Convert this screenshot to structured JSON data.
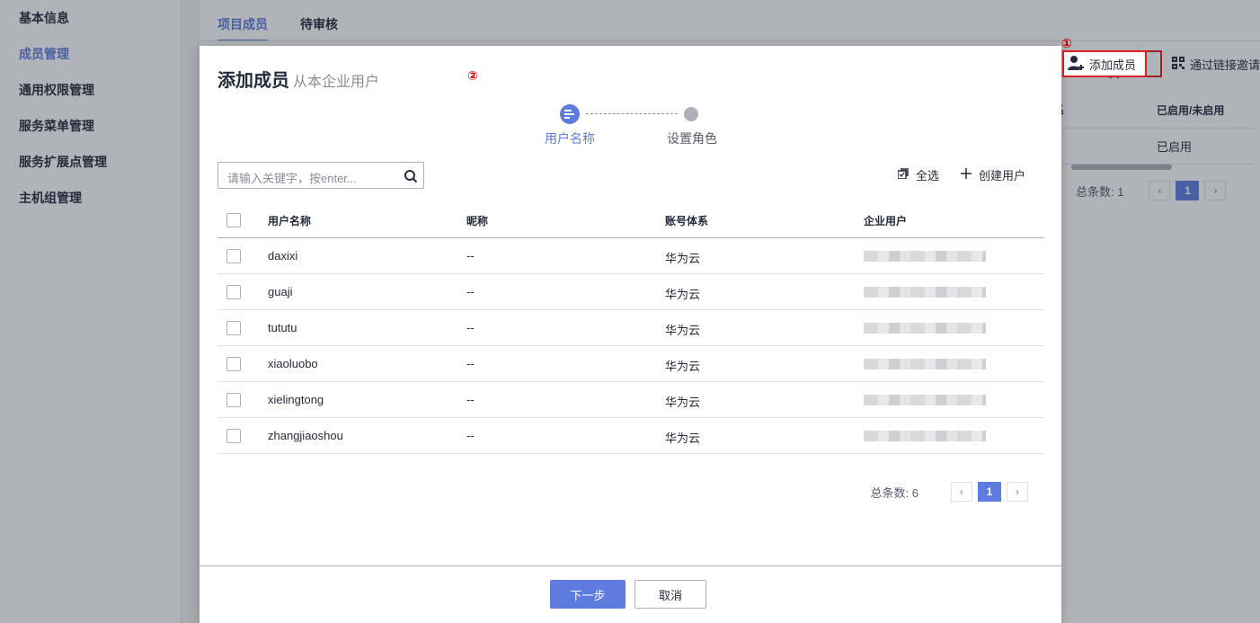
{
  "sidebar": {
    "items": [
      {
        "label": "基本信息"
      },
      {
        "label": "成员管理",
        "active": true
      },
      {
        "label": "通用权限管理"
      },
      {
        "label": "服务菜单管理"
      },
      {
        "label": "服务扩展点管理"
      },
      {
        "label": "主机组管理"
      }
    ]
  },
  "background": {
    "tabs": [
      {
        "label": "项目成员",
        "active": true
      },
      {
        "label": "待审核"
      }
    ],
    "add_member_label": "添加成员",
    "invite_link_label": "通过链接邀请",
    "marker_1": "①",
    "column_partial": "系",
    "column_status": "已启用/未启用",
    "row_status": "已启用",
    "total": "总条数: 1",
    "page": "1"
  },
  "dialog": {
    "title": "添加成员",
    "subtitle": "从本企业用户",
    "marker_2": "②",
    "steps": [
      {
        "label": "用户名称",
        "active": true
      },
      {
        "label": "设置角色"
      }
    ],
    "search_placeholder": "请输入关键字，按enter...",
    "select_all_label": "全选",
    "create_user_label": "创建用户",
    "columns": {
      "username": "用户名称",
      "nickname": "昵称",
      "account_system": "账号体系",
      "enterprise_user": "企业用户"
    },
    "rows": [
      {
        "username": "daxixi",
        "nickname": "--",
        "account_system": "华为云"
      },
      {
        "username": "guaji",
        "nickname": "--",
        "account_system": "华为云"
      },
      {
        "username": "tututu",
        "nickname": "--",
        "account_system": "华为云"
      },
      {
        "username": "xiaoluobo",
        "nickname": "--",
        "account_system": "华为云"
      },
      {
        "username": "xielingtong",
        "nickname": "--",
        "account_system": "华为云"
      },
      {
        "username": "zhangjiaoshou",
        "nickname": "--",
        "account_system": "华为云"
      }
    ],
    "total": "总条数: 6",
    "page": "1",
    "next_label": "下一步",
    "cancel_label": "取消"
  },
  "colors": {
    "primary": "#5e7ce0",
    "marker": "#d40000",
    "highlight_border": "#e02020"
  },
  "icons": [
    "add-user-icon",
    "qr-link-icon",
    "step-list-icon",
    "search-icon",
    "select-all-icon",
    "plus-icon",
    "chevron-left-icon",
    "chevron-right-icon"
  ]
}
